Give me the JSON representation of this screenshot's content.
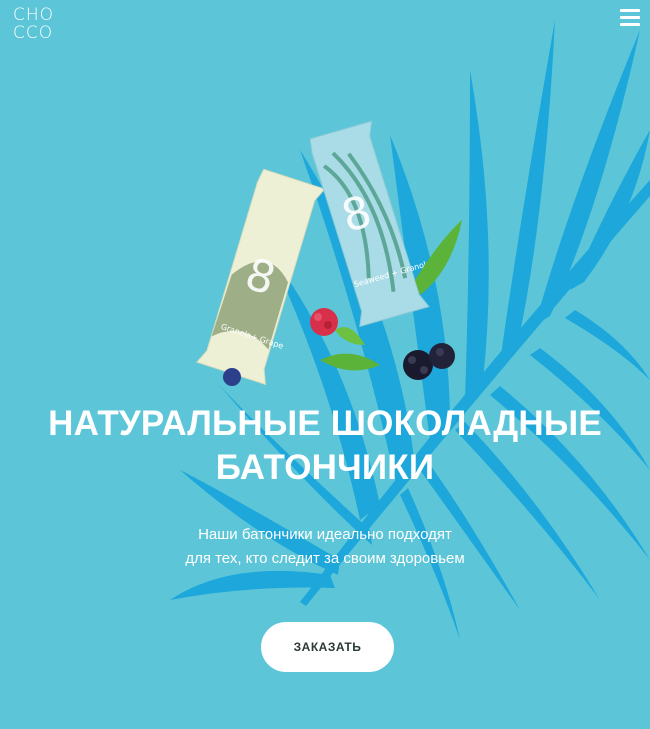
{
  "header": {
    "logo_line1": "CHO",
    "logo_line2": "CCO"
  },
  "hero": {
    "title_line1": "НАТУРАЛЬНЫЕ ШОКОЛАДНЫЕ",
    "title_line2": "БАТОНЧИКИ",
    "subtitle_line1": "Наши батончики идеально подходят",
    "subtitle_line2": "для тех, кто следит за своим здоровьем",
    "cta_label": "ЗАКАЗАТЬ"
  },
  "products": {
    "bar1_number": "8",
    "bar1_name": "Granola+ Grape",
    "bar2_number": "8",
    "bar2_name": "Seaweed + Granola"
  },
  "colors": {
    "background": "#5cc6d8",
    "palm": "#1aa6dc",
    "button_bg": "#ffffff",
    "button_text": "#2b3a35"
  }
}
